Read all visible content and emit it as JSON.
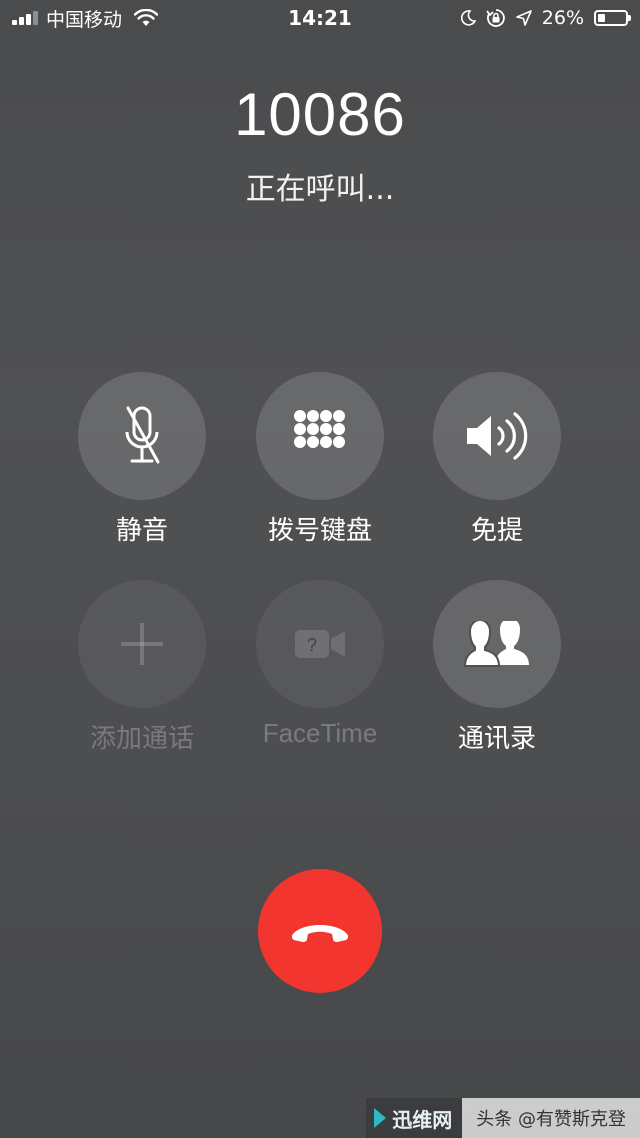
{
  "status_bar": {
    "carrier": "中国移动",
    "time": "14:21",
    "battery_percent": "26%",
    "battery_level": 0.26,
    "icons": [
      "signal-icon",
      "wifi-icon",
      "moon-icon",
      "orientation-lock-icon",
      "location-icon",
      "battery-icon"
    ]
  },
  "call": {
    "number": "10086",
    "status": "正在呼叫..."
  },
  "buttons": {
    "mute": {
      "label": "静音",
      "icon": "mic-off-icon",
      "enabled": true
    },
    "keypad": {
      "label": "拨号键盘",
      "icon": "keypad-icon",
      "enabled": true
    },
    "speaker": {
      "label": "免提",
      "icon": "speaker-icon",
      "enabled": true
    },
    "add_call": {
      "label": "添加通话",
      "icon": "plus-icon",
      "enabled": false
    },
    "facetime": {
      "label": "FaceTime",
      "icon": "facetime-icon",
      "enabled": false
    },
    "contacts": {
      "label": "通讯录",
      "icon": "contacts-icon",
      "enabled": true
    }
  },
  "end_call": {
    "icon": "end-call-icon",
    "color": "#f2362f"
  },
  "watermark": {
    "logo": "迅维网",
    "text": "头条 @有赞斯克登"
  }
}
